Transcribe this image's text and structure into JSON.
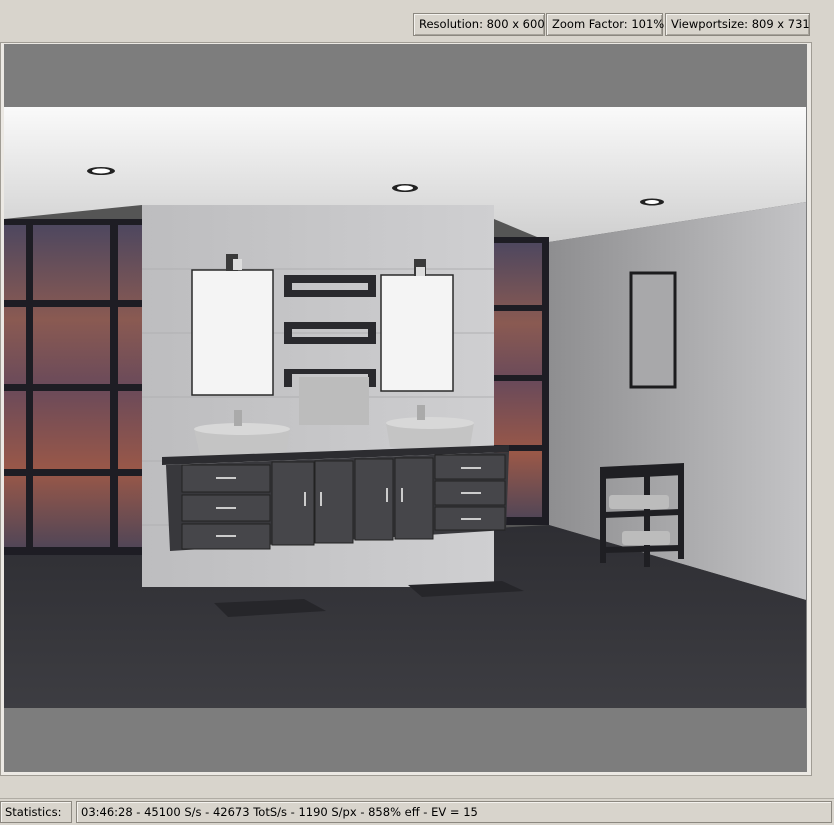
{
  "header": {
    "resolution": "Resolution: 800 x 600",
    "zoom": "Zoom Factor: 101%",
    "viewport_size": "Viewportsize: 809 x 731"
  },
  "statusbar": {
    "label": "Statistics:",
    "value": "03:46:28 - 45100 S/s - 42673 TotS/s - 1190 S/px - 858% eff - EV = 15"
  },
  "colors": {
    "window_bg": "#d8d4cc",
    "viewport_bg": "#7d7d7d"
  }
}
